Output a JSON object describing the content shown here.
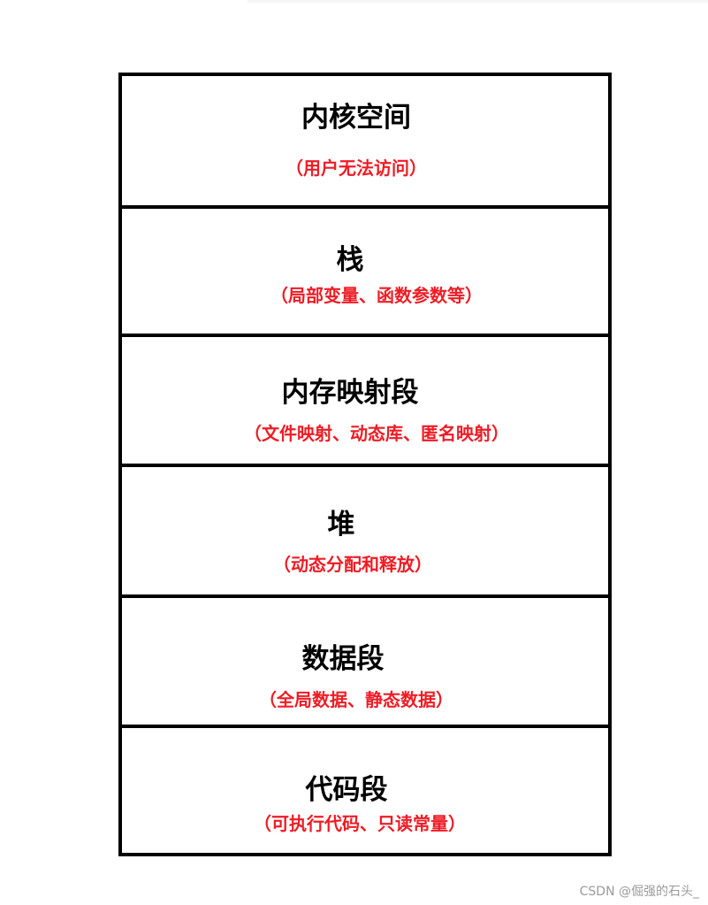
{
  "segments": [
    {
      "title": "内核空间",
      "desc": "（用户无法访问）"
    },
    {
      "title": "栈",
      "desc": "（局部变量、函数参数等）"
    },
    {
      "title": "内存映射段",
      "desc": "（文件映射、动态库、匿名映射）"
    },
    {
      "title": "堆",
      "desc": "（动态分配和释放）"
    },
    {
      "title": "数据段",
      "desc": "（全局数据、静态数据）"
    },
    {
      "title": "代码段",
      "desc": "（可执行代码、只读常量）"
    }
  ],
  "colors": {
    "border": "#000000",
    "title": "#000000",
    "description": "#ee1c25",
    "watermark": "#9a9a9a"
  },
  "watermark": "CSDN @倔强的石头_"
}
